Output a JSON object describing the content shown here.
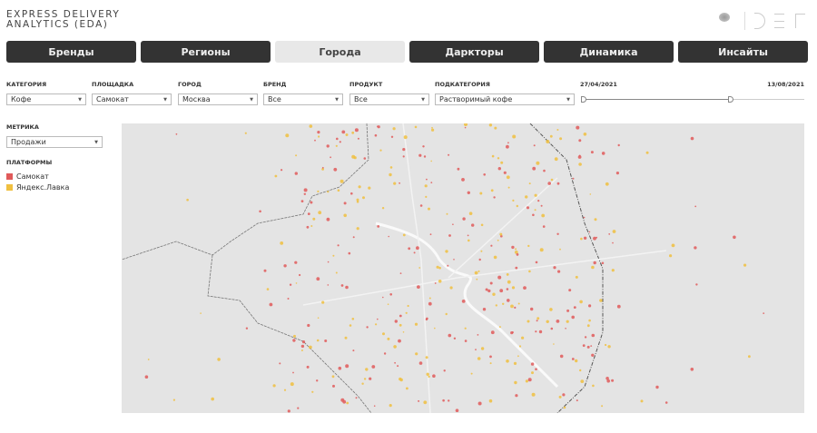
{
  "header": {
    "title_line1": "EXPRESS DELIVERY",
    "title_line2": "ANALYTICS (EDA)",
    "logo_text": "PUBLICIS GROUPE"
  },
  "tabs": [
    {
      "label": "Бренды",
      "active": false
    },
    {
      "label": "Регионы",
      "active": false
    },
    {
      "label": "Города",
      "active": true
    },
    {
      "label": "Даркторы",
      "active": false
    },
    {
      "label": "Динамика",
      "active": false
    },
    {
      "label": "Инсайты",
      "active": false
    }
  ],
  "filters": {
    "category": {
      "label": "КАТЕГОРИЯ",
      "value": "Кофе"
    },
    "platform": {
      "label": "ПЛОЩАДКА",
      "value": "Самокат"
    },
    "city": {
      "label": "ГОРОД",
      "value": "Москва"
    },
    "brand": {
      "label": "БРЕНД",
      "value": "Все"
    },
    "product": {
      "label": "ПРОДУКТ",
      "value": "Все"
    },
    "subcategory": {
      "label": "ПОДКАТЕГОРИЯ",
      "value": "Растворимый кофе"
    }
  },
  "date_range": {
    "start": "27/04/2021",
    "end": "13/08/2021",
    "handle_left_fraction": 0,
    "handle_right_fraction": 0.67
  },
  "metric": {
    "label": "МЕТРИКА",
    "value": "Продажи"
  },
  "platforms": {
    "label": "ПЛАТФОРМЫ",
    "items": [
      {
        "name": "Самокат",
        "color": "#e05a5a"
      },
      {
        "name": "Яндекс.Лавка",
        "color": "#f0c040"
      }
    ]
  }
}
